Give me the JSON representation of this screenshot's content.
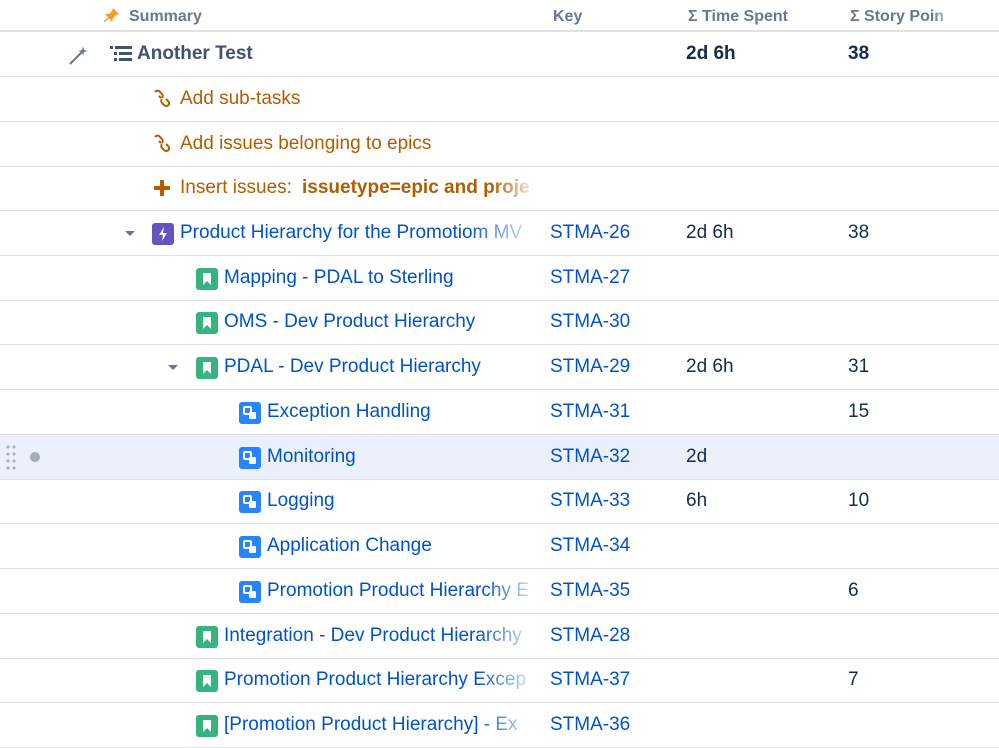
{
  "header": {
    "summary": "Summary",
    "key": "Key",
    "time_spent": "Σ Time Spent",
    "story_points": "Σ Story Poin"
  },
  "root": {
    "title": "Another Test",
    "time": "2d 6h",
    "sp": "38"
  },
  "actions": {
    "add_subtasks": "Add sub-tasks",
    "add_epics": "Add issues belonging to epics",
    "insert_prefix": "Insert issues:",
    "insert_query": "issuetype=epic and proje"
  },
  "rows": [
    {
      "summary": "Product Hierarchy for the Promotiom MV",
      "key": "STMA-26",
      "time": "2d 6h",
      "sp": "38"
    },
    {
      "summary": "Mapping - PDAL to Sterling",
      "key": "STMA-27",
      "time": "",
      "sp": ""
    },
    {
      "summary": "OMS - Dev Product Hierarchy",
      "key": "STMA-30",
      "time": "",
      "sp": ""
    },
    {
      "summary": "PDAL - Dev Product Hierarchy",
      "key": "STMA-29",
      "time": "2d 6h",
      "sp": "31"
    },
    {
      "summary": "Exception Handling",
      "key": "STMA-31",
      "time": "",
      "sp": "15"
    },
    {
      "summary": "Monitoring",
      "key": "STMA-32",
      "time": "2d",
      "sp": ""
    },
    {
      "summary": "Logging",
      "key": "STMA-33",
      "time": "6h",
      "sp": "10"
    },
    {
      "summary": "Application Change",
      "key": "STMA-34",
      "time": "",
      "sp": ""
    },
    {
      "summary": "Promotion Product Hierarchy E",
      "key": "STMA-35",
      "time": "",
      "sp": "6"
    },
    {
      "summary": "Integration - Dev Product Hierarchy",
      "key": "STMA-28",
      "time": "",
      "sp": ""
    },
    {
      "summary": "Promotion Product Hierarchy Excep",
      "key": "STMA-37",
      "time": "",
      "sp": "7"
    },
    {
      "summary": "[Promotion Product Hierarchy] - Ex",
      "key": "STMA-36",
      "time": "",
      "sp": ""
    }
  ],
  "colors": {
    "link": "#0052cc",
    "action": "#b35c00",
    "epic": "#6554c0",
    "story": "#36b37e",
    "subtask": "#2684ff",
    "selected_row": "#ebf0fa"
  }
}
